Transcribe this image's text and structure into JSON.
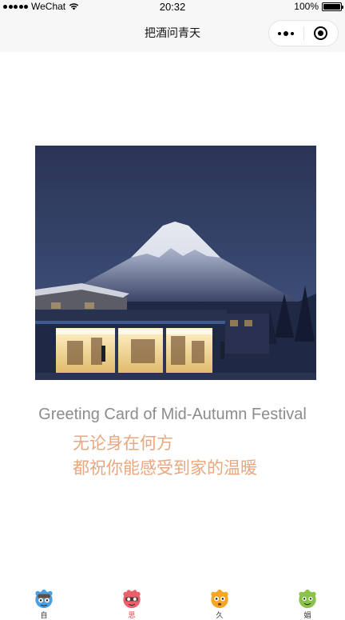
{
  "status_bar": {
    "carrier": "WeChat",
    "time": "20:32",
    "battery": "100%",
    "battery_level": 1.0
  },
  "nav": {
    "title": "把酒问青天",
    "more_icon": "more-dots-icon",
    "close_icon": "close-circle-icon"
  },
  "card": {
    "photo_caption": "",
    "en_title": "Greeting Card of Mid-Autumn Festival",
    "cn_line1": "无论身在何方",
    "cn_line2": "都祝你能感受到家的温暖"
  },
  "tabs": [
    {
      "label": "自",
      "icon": "blue-monster-icon",
      "color": "#4a9fe0",
      "active": false
    },
    {
      "label": "思",
      "icon": "red-monster-icon",
      "color": "#ec5f6a",
      "active": true
    },
    {
      "label": "久",
      "icon": "orange-monster-icon",
      "color": "#f5a623",
      "active": false
    },
    {
      "label": "娼",
      "icon": "green-monster-icon",
      "color": "#8bc34a",
      "active": false
    }
  ],
  "colors": {
    "en_title": "#8c8c8c",
    "cn_text": "#e8a77f",
    "active_tab": "#d94a4a"
  }
}
